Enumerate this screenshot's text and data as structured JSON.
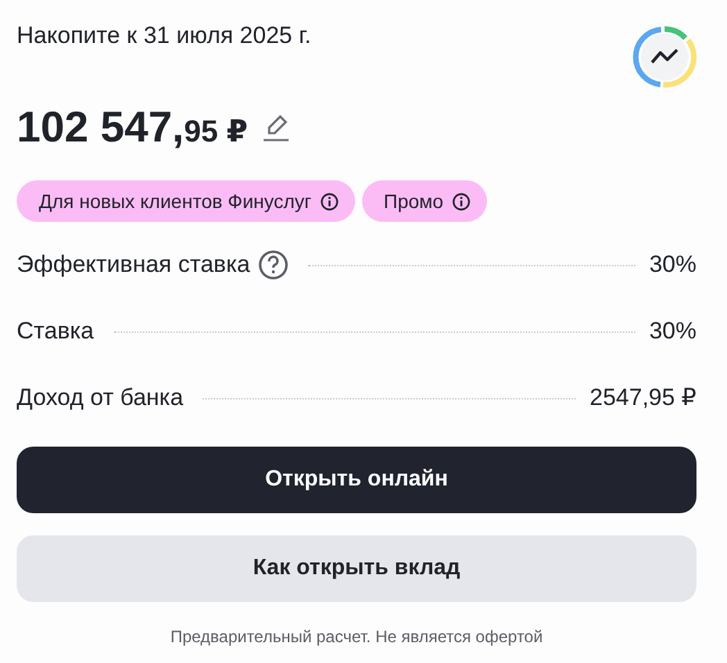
{
  "goal": {
    "title": "Накопите к 31 июля 2025 г.",
    "amount_whole": "102 547,",
    "amount_fraction": "95 ₽"
  },
  "chips": [
    {
      "label": "Для новых клиентов Финуслуг"
    },
    {
      "label": "Промо"
    }
  ],
  "rows": [
    {
      "label": "Эффективная ставка",
      "hint": true,
      "value": "30%"
    },
    {
      "label": "Ставка",
      "hint": false,
      "value": "30%"
    },
    {
      "label": "Доход от банка",
      "hint": false,
      "value": "2547,95 ₽"
    }
  ],
  "buttons": [
    {
      "label": "Открыть онлайн",
      "kind": "primary"
    },
    {
      "label": "Как открыть вклад",
      "kind": "secondary"
    }
  ],
  "disclaimer": "Предварительный расчет. Не является офертой"
}
